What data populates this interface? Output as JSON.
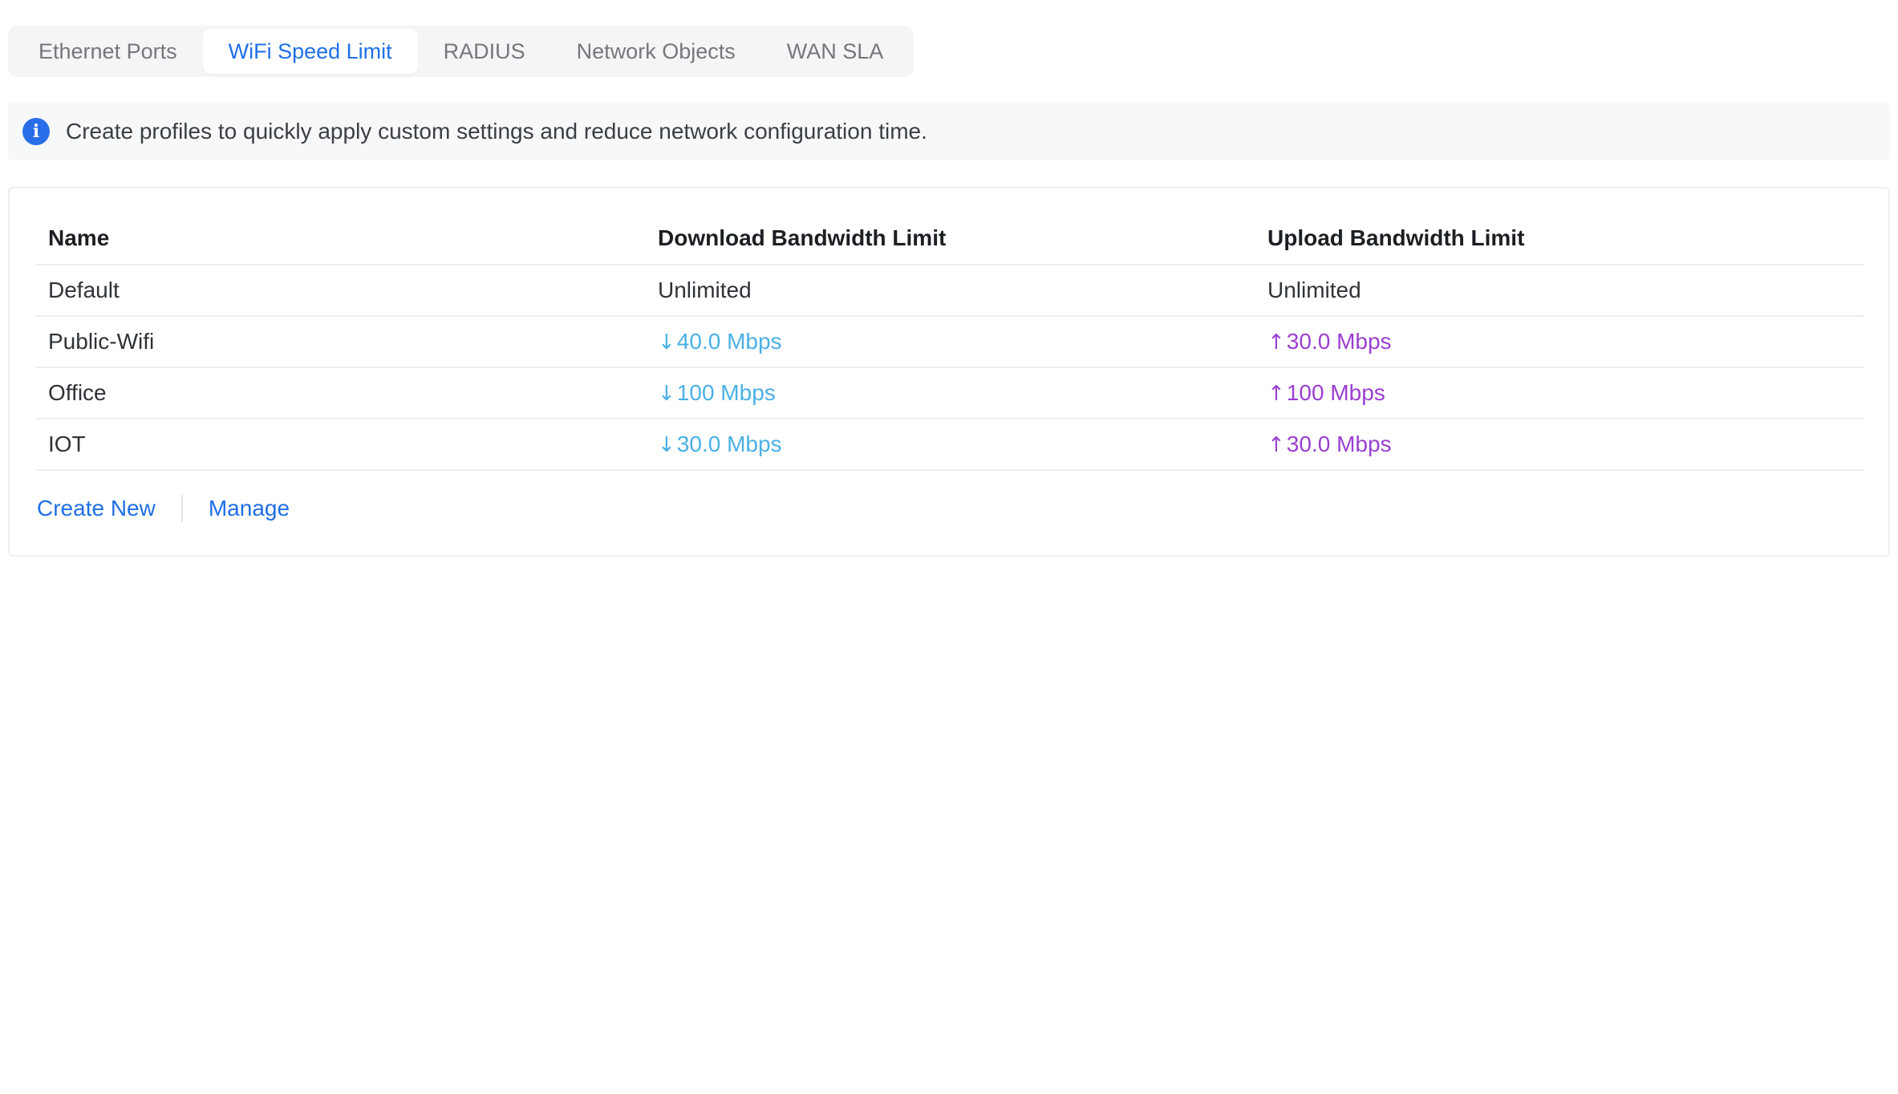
{
  "tabs": [
    {
      "label": "Ethernet Ports",
      "active": false
    },
    {
      "label": "WiFi Speed Limit",
      "active": true
    },
    {
      "label": "RADIUS",
      "active": false
    },
    {
      "label": "Network Objects",
      "active": false
    },
    {
      "label": "WAN SLA",
      "active": false
    }
  ],
  "banner": {
    "icon": "info-icon",
    "text": "Create profiles to quickly apply custom settings and reduce network configuration time."
  },
  "table": {
    "columns": [
      "Name",
      "Download Bandwidth Limit",
      "Upload Bandwidth Limit"
    ],
    "rows": [
      {
        "name": "Default",
        "download": "Unlimited",
        "download_arrow": "",
        "upload": "Unlimited",
        "upload_arrow": ""
      },
      {
        "name": "Public-Wifi",
        "download": "40.0 Mbps",
        "download_arrow": "↓",
        "upload": "30.0 Mbps",
        "upload_arrow": "↑"
      },
      {
        "name": "Office",
        "download": "100 Mbps",
        "download_arrow": "↓",
        "upload": "100 Mbps",
        "upload_arrow": "↑"
      },
      {
        "name": "IOT",
        "download": "30.0 Mbps",
        "download_arrow": "↓",
        "upload": "30.0 Mbps",
        "upload_arrow": "↑"
      }
    ]
  },
  "actions": {
    "create_new": "Create New",
    "manage": "Manage"
  },
  "colors": {
    "accent": "#1f6fe6",
    "download": "#4ab0e5",
    "upload": "#9a3fd0"
  }
}
